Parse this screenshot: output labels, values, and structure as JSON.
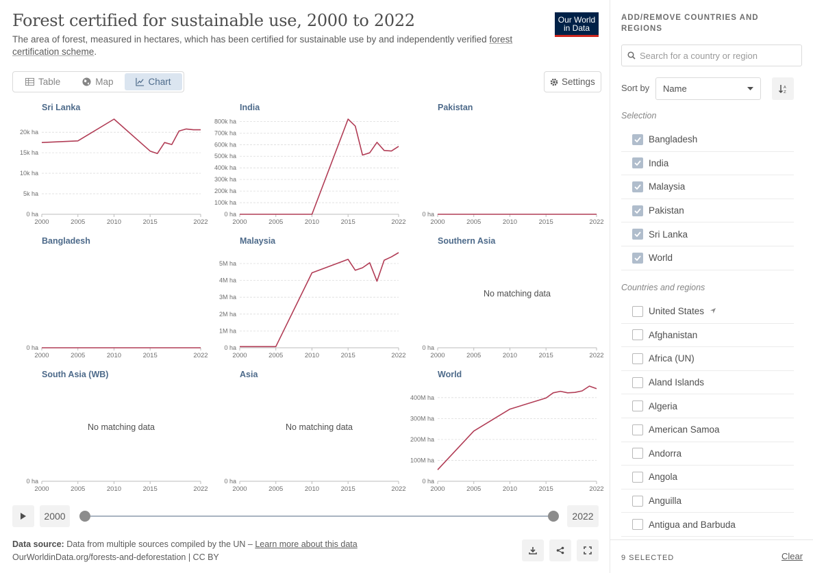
{
  "header": {
    "title": "Forest certified for sustainable use, 2000 to 2022",
    "subtitle_prefix": "The area of forest, measured in hectares, which has been certified for sustainable use by and independently verified ",
    "subtitle_link": "forest certification scheme",
    "subtitle_suffix": ".",
    "logo_line1": "Our World",
    "logo_line2": "in Data"
  },
  "tabs": [
    {
      "label": "Table",
      "icon": "table-icon"
    },
    {
      "label": "Map",
      "icon": "globe-icon"
    },
    {
      "label": "Chart",
      "icon": "line-chart-icon",
      "active": true
    }
  ],
  "settings_label": "Settings",
  "chart_data": [
    {
      "type": "line",
      "title": "Sri Lanka",
      "x": [
        2000,
        2005,
        2010,
        2015,
        2016,
        2017,
        2018,
        2019,
        2020,
        2021,
        2022
      ],
      "y": [
        17500,
        17900,
        23200,
        15400,
        14800,
        17500,
        17000,
        20300,
        20800,
        20600,
        20600
      ],
      "ylim": [
        0,
        23200
      ],
      "yticks": [
        "0 ha",
        "5k ha",
        "10k ha",
        "15k ha",
        "20k ha"
      ],
      "ytick_values": [
        0,
        5000,
        10000,
        15000,
        20000
      ],
      "xticks": [
        "2000",
        "2005",
        "2010",
        "2015",
        "2022"
      ]
    },
    {
      "type": "line",
      "title": "India",
      "x": [
        2000,
        2005,
        2010,
        2015,
        2016,
        2017,
        2018,
        2019,
        2020,
        2021,
        2022
      ],
      "y": [
        0,
        0,
        0,
        820000,
        760000,
        510000,
        530000,
        620000,
        550000,
        545000,
        585000
      ],
      "ylim": [
        0,
        820000
      ],
      "yticks": [
        "0 ha",
        "100k ha",
        "200k ha",
        "300k ha",
        "400k ha",
        "500k ha",
        "600k ha",
        "700k ha",
        "800k ha"
      ],
      "ytick_values": [
        0,
        100000,
        200000,
        300000,
        400000,
        500000,
        600000,
        700000,
        800000
      ],
      "xticks": [
        "2000",
        "2005",
        "2010",
        "2015",
        "2022"
      ]
    },
    {
      "type": "line",
      "title": "Pakistan",
      "x": [
        2000,
        2022
      ],
      "y": [
        0,
        0
      ],
      "ylim": [
        0,
        1
      ],
      "yticks": [
        "0 ha"
      ],
      "ytick_values": [
        0
      ],
      "xticks": [
        "2000",
        "2005",
        "2010",
        "2015",
        "2022"
      ]
    },
    {
      "type": "line",
      "title": "Bangladesh",
      "x": [
        2000,
        2022
      ],
      "y": [
        0,
        0
      ],
      "ylim": [
        0,
        1
      ],
      "yticks": [
        "0 ha"
      ],
      "ytick_values": [
        0
      ],
      "xticks": [
        "2000",
        "2005",
        "2010",
        "2015",
        "2022"
      ]
    },
    {
      "type": "line",
      "title": "Malaysia",
      "x": [
        2000,
        2005,
        2010,
        2015,
        2016,
        2017,
        2018,
        2019,
        2020,
        2021,
        2022
      ],
      "y": [
        70000,
        70000,
        4450000,
        5250000,
        4600000,
        4750000,
        5050000,
        3950000,
        5200000,
        5400000,
        5650000
      ],
      "ylim": [
        0,
        5650000
      ],
      "yticks": [
        "0 ha",
        "1M ha",
        "2M ha",
        "3M ha",
        "4M ha",
        "5M ha"
      ],
      "ytick_values": [
        0,
        1000000,
        2000000,
        3000000,
        4000000,
        5000000
      ],
      "xticks": [
        "2000",
        "2005",
        "2010",
        "2015",
        "2022"
      ]
    },
    {
      "type": "line",
      "title": "Southern Asia",
      "no_data": "No matching data",
      "yticks": [
        "0 ha"
      ],
      "ytick_values": [
        0
      ],
      "ylim": [
        0,
        1
      ],
      "xticks": [
        "2000",
        "2005",
        "2010",
        "2015",
        "2022"
      ]
    },
    {
      "type": "line",
      "title": "South Asia (WB)",
      "no_data": "No matching data",
      "yticks": [
        "0 ha"
      ],
      "ytick_values": [
        0
      ],
      "ylim": [
        0,
        1
      ],
      "xticks": [
        "2000",
        "2005",
        "2010",
        "2015",
        "2022"
      ]
    },
    {
      "type": "line",
      "title": "Asia",
      "no_data": "No matching data",
      "yticks": [
        "0 ha"
      ],
      "ytick_values": [
        0
      ],
      "ylim": [
        0,
        1
      ],
      "xticks": [
        "2000",
        "2005",
        "2010",
        "2015",
        "2022"
      ]
    },
    {
      "type": "line",
      "title": "World",
      "x": [
        2000,
        2005,
        2010,
        2015,
        2016,
        2017,
        2018,
        2019,
        2020,
        2021,
        2022
      ],
      "y": [
        55000000,
        240000000,
        345000000,
        398000000,
        423000000,
        430000000,
        423000000,
        425000000,
        432000000,
        455000000,
        443000000
      ],
      "ylim": [
        0,
        455000000
      ],
      "yticks": [
        "0 ha",
        "100M ha",
        "200M ha",
        "300M ha",
        "400M ha"
      ],
      "ytick_values": [
        0,
        100000000,
        200000000,
        300000000,
        400000000
      ],
      "xticks": [
        "2000",
        "2005",
        "2010",
        "2015",
        "2022"
      ]
    }
  ],
  "colors": {
    "line": "#b13c55",
    "accent": "#4d6a8a"
  },
  "timeline": {
    "start_year": "2000",
    "end_year": "2022"
  },
  "footer": {
    "source_label": "Data source:",
    "source_text": " Data from multiple sources compiled by the UN – ",
    "source_link": "Learn more about this data",
    "url_text": "OurWorldinData.org/forests-and-deforestation | CC BY"
  },
  "sidebar": {
    "title": "Add/remove countries and regions",
    "search_placeholder": "Search for a country or region",
    "sort_label": "Sort by",
    "sort_value": "Name",
    "selection_header": "Selection",
    "selected": [
      "Bangladesh",
      "India",
      "Malaysia",
      "Pakistan",
      "Sri Lanka",
      "World"
    ],
    "countries_header": "Countries and regions",
    "countries": [
      "United States",
      "Afghanistan",
      "Africa (UN)",
      "Aland Islands",
      "Algeria",
      "American Samoa",
      "Andorra",
      "Angola",
      "Anguilla",
      "Antigua and Barbuda"
    ],
    "selected_count": "9 SELECTED",
    "clear_label": "Clear"
  }
}
